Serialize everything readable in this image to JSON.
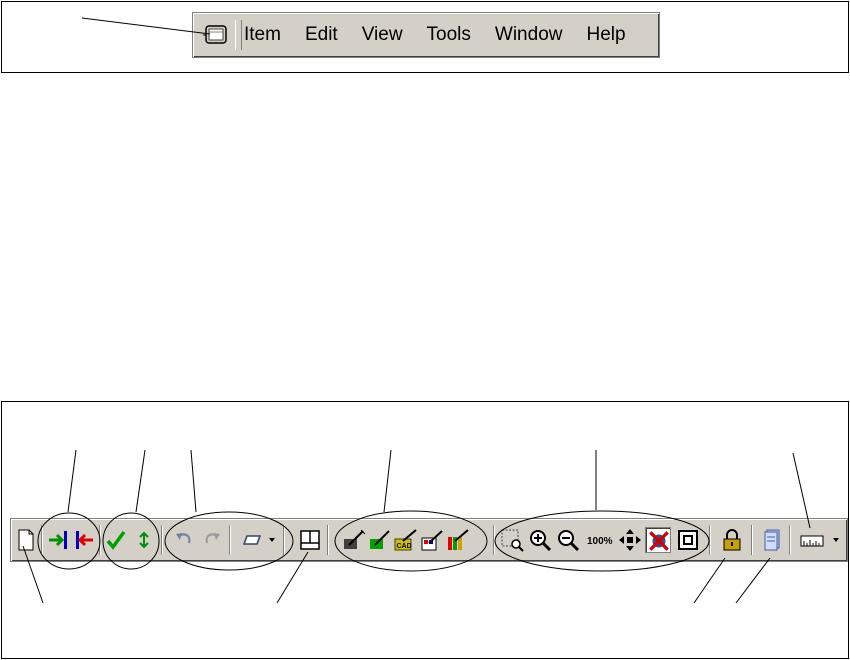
{
  "menubar": {
    "items": [
      {
        "label": "Item"
      },
      {
        "label": "Edit"
      },
      {
        "label": "View"
      },
      {
        "label": "Tools"
      },
      {
        "label": "Window"
      },
      {
        "label": "Help"
      }
    ],
    "app_icon": "window-control-icon"
  },
  "toolbar": {
    "zoom_100_label": "100%",
    "cad_label": "CAD",
    "buttons": [
      {
        "name": "new-document-icon"
      },
      {
        "name": "check-in-icon"
      },
      {
        "name": "check-out-icon"
      },
      {
        "name": "approve-icon"
      },
      {
        "name": "refresh-icon"
      },
      {
        "name": "undo-icon"
      },
      {
        "name": "redo-icon"
      },
      {
        "name": "view-selector-icon"
      },
      {
        "name": "split-view-icon"
      },
      {
        "name": "edit-tool-1-icon"
      },
      {
        "name": "edit-tool-2-icon"
      },
      {
        "name": "cad-tool-icon"
      },
      {
        "name": "edit-tool-4-icon"
      },
      {
        "name": "edit-tool-5-icon"
      },
      {
        "name": "zoom-window-icon"
      },
      {
        "name": "zoom-in-icon"
      },
      {
        "name": "zoom-out-icon"
      },
      {
        "name": "zoom-100-icon"
      },
      {
        "name": "pan-icon"
      },
      {
        "name": "disabled-x-icon"
      },
      {
        "name": "fit-icon"
      },
      {
        "name": "lock-icon"
      },
      {
        "name": "document-stack-icon"
      },
      {
        "name": "measure-icon"
      }
    ]
  },
  "colors": {
    "chrome": "#d4d0c8",
    "highlight": "#ffffff",
    "shadow": "#808080",
    "green": "#009000",
    "red": "#e00000",
    "blue": "#0000c0"
  }
}
